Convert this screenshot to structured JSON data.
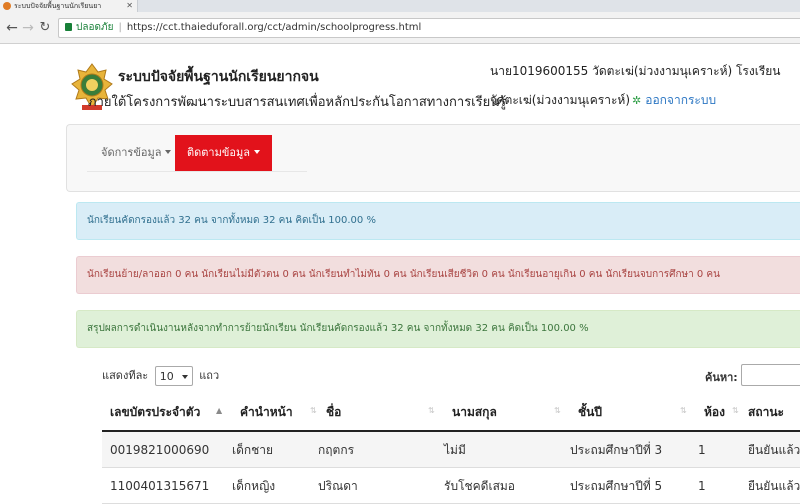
{
  "browser": {
    "tab_title": "ระบบปัจจัยพื้นฐานนักเรียนยา",
    "secure_label": "ปลอดภัย",
    "url": "https://cct.thaieduforall.org/cct/admin/schoolprogress.html"
  },
  "header": {
    "title": "ระบบปัจจัยพื้นฐานนักเรียนยากจน",
    "subtitle": "ภายใต้โครงการพัฒนาระบบสารสนเทศเพื่อหลักประกันโอกาสทางการเรียนรู้",
    "user_name": "นาย1019600155 วัดตะเฆ่(ม่วงงามนุเคราะห์)  โรงเรียน",
    "school": "วัดตะเฆ่(ม่วงงามนุเคราะห์)",
    "logout": "ออกจากระบบ"
  },
  "navbar": {
    "manage_data": "จัดการข้อมูล",
    "follow_data": "ติดตามข้อมูล",
    "active_color": "#e2121b"
  },
  "alerts": {
    "info": "นักเรียนคัดกรองแล้ว  32  คน  จากทั้งหมด 32 คน คิดเป็น 100.00 %",
    "danger": "นักเรียนย้าย/ลาออก  0  คน นักเรียนไม่มีตัวตน 0 คน นักเรียนทำไม่ทัน   0 คน นักเรียนเสียชีวิต  0 คน   นักเรียนอายุเกิน   0 คน นักเรียนจบการศึกษา 0 คน",
    "success": "สรุปผลการดำเนินงานหลังจากทำการย้ายนักเรียน นักเรียนคัดกรองแล้ว 32  คน  จากทั้งหมด 32 คน คิดเป็น 100.00 %"
  },
  "table_controls": {
    "show_label": "แสดงทีละ",
    "page_size": "10",
    "rows_label": "แถว",
    "search_label": "ค้นหา:"
  },
  "table": {
    "headers": [
      "เลขบัตรประจำตัว",
      "คำนำหน้า",
      "ชื่อ",
      "นามสกุล",
      "ชั้นปี",
      "ห้อง",
      "สถานะ"
    ],
    "rows": [
      [
        "0019821000690",
        "เด็กชาย",
        "กฤตกร",
        "ไม่มี",
        "ประถมศึกษาปีที่ 3",
        "1",
        "ยืนยันแล้ว"
      ],
      [
        "1100401315671",
        "เด็กหญิง",
        "ปริณดา",
        "รับโชคดีเสมอ",
        "ประถมศึกษาปีที่ 5",
        "1",
        "ยืนยันแล้ว"
      ]
    ]
  }
}
